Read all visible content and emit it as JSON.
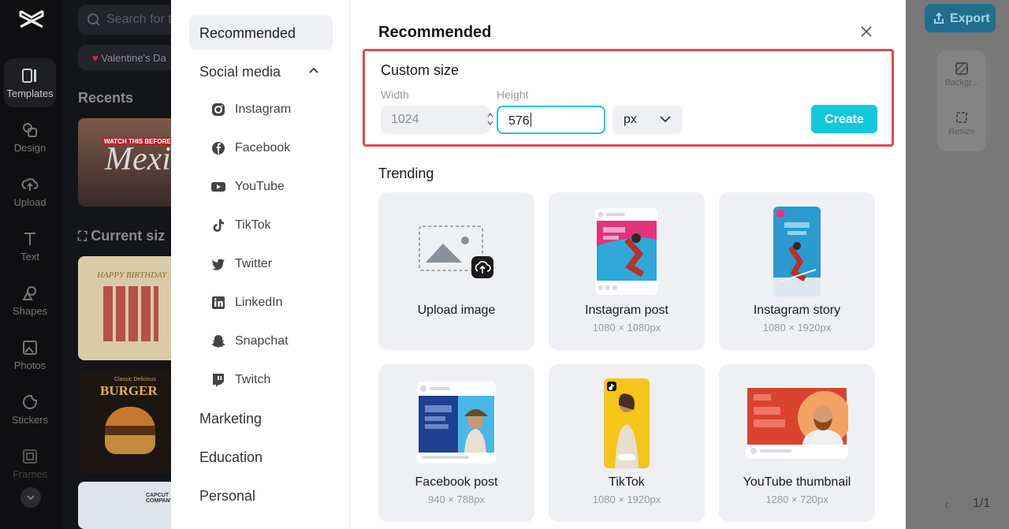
{
  "left_rail": {
    "items": [
      {
        "label": "Templates",
        "icon": "templates-icon",
        "active": true
      },
      {
        "label": "Design",
        "icon": "design-icon"
      },
      {
        "label": "Upload",
        "icon": "upload-icon"
      },
      {
        "label": "Text",
        "icon": "text-icon"
      },
      {
        "label": "Shapes",
        "icon": "shapes-icon"
      },
      {
        "label": "Photos",
        "icon": "photos-icon"
      },
      {
        "label": "Stickers",
        "icon": "stickers-icon"
      },
      {
        "label": "Frames",
        "icon": "frames-icon"
      }
    ]
  },
  "background_panel": {
    "search_placeholder": "Search for t",
    "chip_label": "Valentine's Da",
    "recents_title": "Recents",
    "current_size_title": "Current siz",
    "thumb_mexico_text": "Mexi",
    "thumb_mexico_banner": "WATCH THIS BEFORE Y",
    "thumb_birthday_text": "HAPPY BIRTHDAY",
    "thumb_burger_text": "BURGER",
    "thumb_burger_sub": "Classic Delicious",
    "thumb_company_text": "CAPCUT COMPANY"
  },
  "right_panel": {
    "export_label": "Export",
    "tools": [
      {
        "label": "Backgr..."
      },
      {
        "label": "Resize"
      }
    ],
    "pager": "1/1"
  },
  "modal": {
    "nav": {
      "recommended": "Recommended",
      "social_media": "Social media",
      "social_items": [
        "Instagram",
        "Facebook",
        "YouTube",
        "TikTok",
        "Twitter",
        "LinkedIn",
        "Snapchat",
        "Twitch"
      ],
      "marketing": "Marketing",
      "education": "Education",
      "personal": "Personal"
    },
    "title": "Recommended",
    "custom_size": {
      "title": "Custom size",
      "width_label": "Width",
      "width_value": "1024",
      "height_label": "Height",
      "height_value": "576",
      "unit": "px",
      "create_label": "Create"
    },
    "trending_title": "Trending",
    "cards": [
      {
        "name": "Upload image",
        "dims": ""
      },
      {
        "name": "Instagram post",
        "dims": "1080 × 1080px"
      },
      {
        "name": "Instagram story",
        "dims": "1080 × 1920px"
      },
      {
        "name": "Facebook post",
        "dims": "940 × 788px"
      },
      {
        "name": "TikTok",
        "dims": "1080 × 1920px"
      },
      {
        "name": "YouTube thumbnail",
        "dims": "1280 × 720px"
      }
    ]
  },
  "colors": {
    "accent": "#12c8dd",
    "highlight_border": "#e5484d",
    "rail_bg": "#0f0f11"
  }
}
